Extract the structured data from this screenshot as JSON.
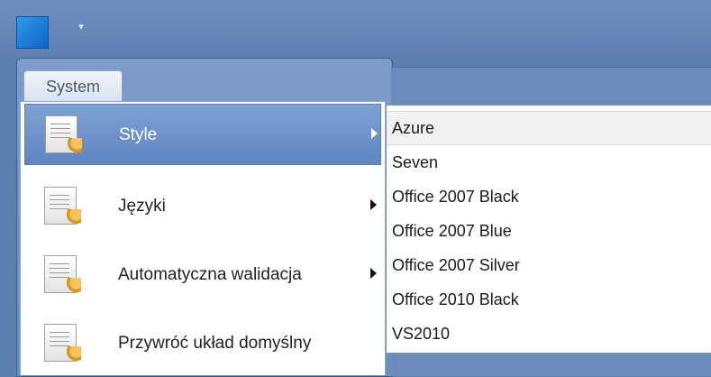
{
  "titlebar": {
    "app_icon": "network-icon",
    "qat_dropdown_glyph": "▾"
  },
  "ribbon": {
    "tab_label": "System"
  },
  "menu": {
    "items": [
      {
        "label": "Style",
        "icon": "document-wrench-icon",
        "has_submenu": true,
        "active": true
      },
      {
        "label": "Języki",
        "icon": "document-wrench-icon",
        "has_submenu": true,
        "active": false
      },
      {
        "label": "Automatyczna walidacja",
        "icon": "document-wrench-icon",
        "has_submenu": true,
        "active": false
      },
      {
        "label": "Przywróć układ domyślny",
        "icon": "document-wrench-icon",
        "has_submenu": false,
        "active": false
      }
    ]
  },
  "submenu": {
    "items": [
      {
        "label": "Azure",
        "highlight": true
      },
      {
        "label": "Seven"
      },
      {
        "label": "Office 2007 Black"
      },
      {
        "label": "Office 2007 Blue"
      },
      {
        "label": "Office 2007 Silver"
      },
      {
        "label": "Office 2010 Black"
      },
      {
        "label": "VS2010"
      }
    ]
  },
  "colors": {
    "titlebar": "#6f8fc0",
    "active_item": "#6f93cc",
    "menu_bg": "#ffffff"
  }
}
